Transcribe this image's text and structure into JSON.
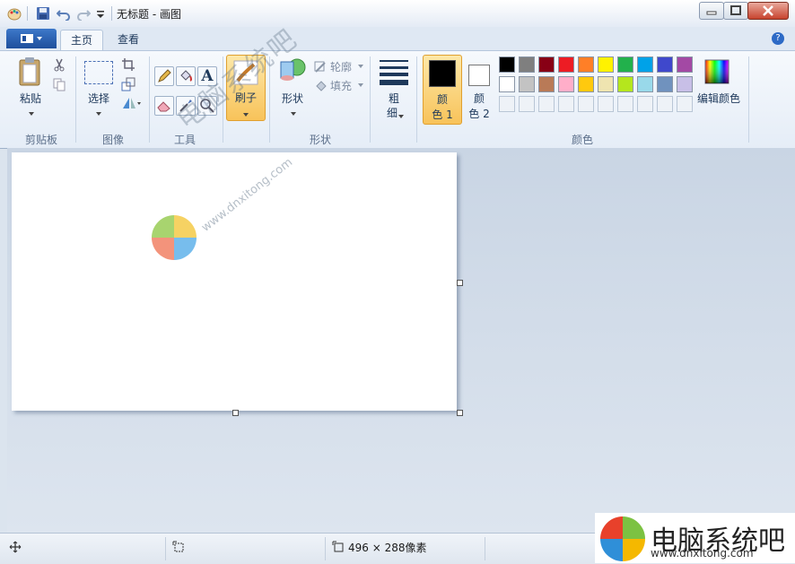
{
  "window": {
    "title": "无标题 - 画图"
  },
  "tabs": [
    {
      "label": "主页"
    },
    {
      "label": "查看"
    }
  ],
  "help": {
    "label": "?"
  },
  "ribbon": {
    "clipboard": {
      "group_label": "剪贴板",
      "paste_label": "粘贴"
    },
    "image": {
      "group_label": "图像",
      "select_label": "选择"
    },
    "tools": {
      "group_label": "工具",
      "text_glyph": "A"
    },
    "brushes": {
      "label": "刷子"
    },
    "shapes": {
      "group_label": "形状",
      "shapes_label": "形状",
      "outline_label": "轮廓",
      "fill_label": "填充"
    },
    "size": {
      "label_1": "粗",
      "label_2": "细"
    },
    "colors": {
      "group_label": "颜色",
      "color1_line1": "颜",
      "color1_line2": "色 1",
      "color2_line1": "颜",
      "color2_line2": "色 2",
      "edit_label": "编辑颜色",
      "color1": "#000000",
      "color2": "#ffffff",
      "row1": [
        "#000000",
        "#7f7f7f",
        "#880015",
        "#ed1c24",
        "#ff7f27",
        "#fff200",
        "#22b14c",
        "#00a2e8",
        "#3f48cc",
        "#a349a4"
      ],
      "row2": [
        "#ffffff",
        "#c3c3c3",
        "#b97a57",
        "#ffaec9",
        "#ffc90e",
        "#efe4b0",
        "#b5e61d",
        "#99d9ea",
        "#7092be",
        "#c8bfe7"
      ]
    }
  },
  "statusbar": {
    "image_size": "496 × 288像素"
  },
  "watermark": {
    "text": "电脑系统吧",
    "url": "www.dnxitong.com"
  },
  "brand": {
    "name": "电脑系统吧",
    "url": "www.dnxitong.com"
  }
}
